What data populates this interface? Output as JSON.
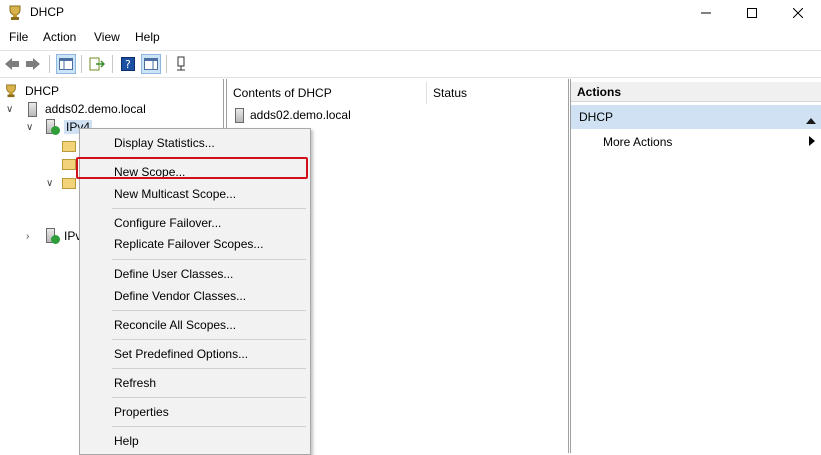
{
  "window": {
    "title": "DHCP"
  },
  "menubar": {
    "file": "File",
    "action": "Action",
    "view": "View",
    "help": "Help"
  },
  "tree": {
    "root": "DHCP",
    "server": "adds02.demo.local",
    "ipv4": "IPv4",
    "ipv6": "IPv"
  },
  "contents": {
    "col_name": "Contents of DHCP",
    "col_status": "Status",
    "rows": [
      {
        "name": "adds02.demo.local",
        "status": ""
      }
    ]
  },
  "actions": {
    "title": "Actions",
    "section": "DHCP",
    "more": "More Actions"
  },
  "context_menu": {
    "items": [
      "Display Statistics...",
      "New Scope...",
      "New Multicast Scope...",
      "Configure Failover...",
      "Replicate Failover Scopes...",
      "Define User Classes...",
      "Define Vendor Classes...",
      "Reconcile All Scopes...",
      "Set Predefined Options...",
      "Refresh",
      "Properties",
      "Help"
    ],
    "highlighted": "New Scope..."
  },
  "colors": {
    "highlight_border": "#d0101a",
    "selection": "#cfe1f3"
  }
}
